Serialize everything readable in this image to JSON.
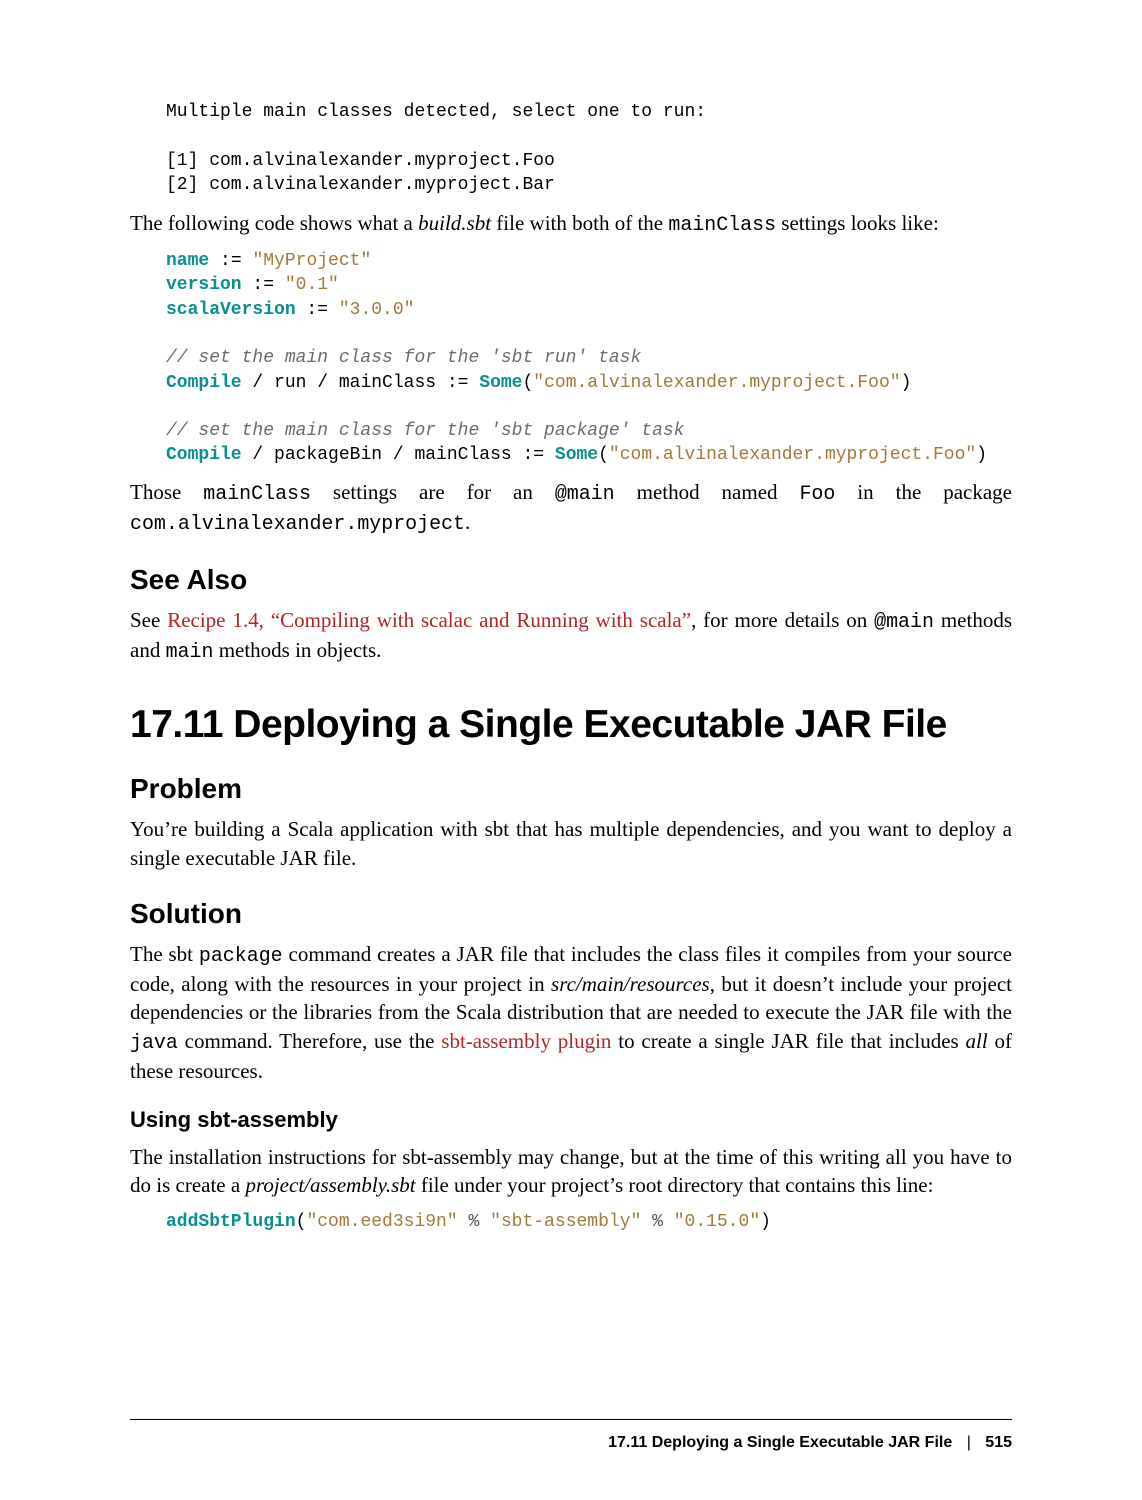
{
  "codeblock1": "Multiple main classes detected, select one to run:\n\n[1] com.alvinalexander.myproject.Foo\n[2] com.alvinalexander.myproject.Bar",
  "para1_a": "The following code shows what a ",
  "para1_b": "build.sbt",
  "para1_c": " file with both of the ",
  "para1_d": "mainClass",
  "para1_e": " settings looks like:",
  "code2": {
    "l1a": "name",
    "l1b": " := ",
    "l1c": "\"MyProject\"",
    "l2a": "version",
    "l2b": " := ",
    "l2c": "\"0.1\"",
    "l3a": "scalaVersion",
    "l3b": " := ",
    "l3c": "\"3.0.0\"",
    "c1": "// set the main class for the 'sbt run' task",
    "l4a": "Compile",
    "l4b": " / run / mainClass := ",
    "l4c": "Some",
    "l4d": "(",
    "l4e": "\"com.alvinalexander.myproject.Foo\"",
    "l4f": ")",
    "c2": "// set the main class for the 'sbt package' task",
    "l5a": "Compile",
    "l5b": " / packageBin / mainClass := ",
    "l5c": "Some",
    "l5d": "(",
    "l5e": "\"com.alvinalexander.myproject.Foo\"",
    "l5f": ")"
  },
  "para2_a": "Those ",
  "para2_b": "mainClass",
  "para2_c": " settings are for an ",
  "para2_d": "@main",
  "para2_e": " method named ",
  "para2_f": "Foo",
  "para2_g": " in the package ",
  "para2_h": "com.alvinalexander.myproject",
  "para2_i": ".",
  "seeAlsoHeading": "See Also",
  "para3_a": "See ",
  "para3_link": "Recipe 1.4, “Compiling with scalac and Running with scala”",
  "para3_b": ", for more details on ",
  "para3_c": "@main",
  "para3_d": " methods and ",
  "para3_e": "main",
  "para3_f": " methods in objects.",
  "h1": "17.11 Deploying a Single Executable JAR File",
  "problemHeading": "Problem",
  "para4": "You’re building a Scala application with sbt that has multiple dependencies, and you want to deploy a single executable JAR file.",
  "solutionHeading": "Solution",
  "para5_a": "The sbt ",
  "para5_b": "package",
  "para5_c": " command creates a JAR file that includes the class files it compiles from your source code, along with the resources in your project in ",
  "para5_d": "src/main/resources",
  "para5_e": ", but it doesn’t include your project dependencies or the libraries from the Scala distribution that are needed to execute the JAR file with the ",
  "para5_f": "java",
  "para5_g": " command. Therefore, use the ",
  "para5_link": "sbt-assembly plugin",
  "para5_h": " to create a single JAR file that includes ",
  "para5_i": "all",
  "para5_j": " of these resources.",
  "usingHeading": "Using sbt-assembly",
  "para6_a": "The installation instructions for sbt-assembly may change, but at the time of this writing all you have to do is create a ",
  "para6_b": "project/assembly.sbt",
  "para6_c": " file under your project’s root directory that contains this line:",
  "code3": {
    "a": "addSbtPlugin",
    "b": "(",
    "c": "\"com.eed3si9n\"",
    "d": " % ",
    "e": "\"sbt-assembly\"",
    "f": " % ",
    "g": "\"0.15.0\"",
    "h": ")"
  },
  "footer_title": "17.11 Deploying a Single Executable JAR File",
  "footer_page": "515"
}
